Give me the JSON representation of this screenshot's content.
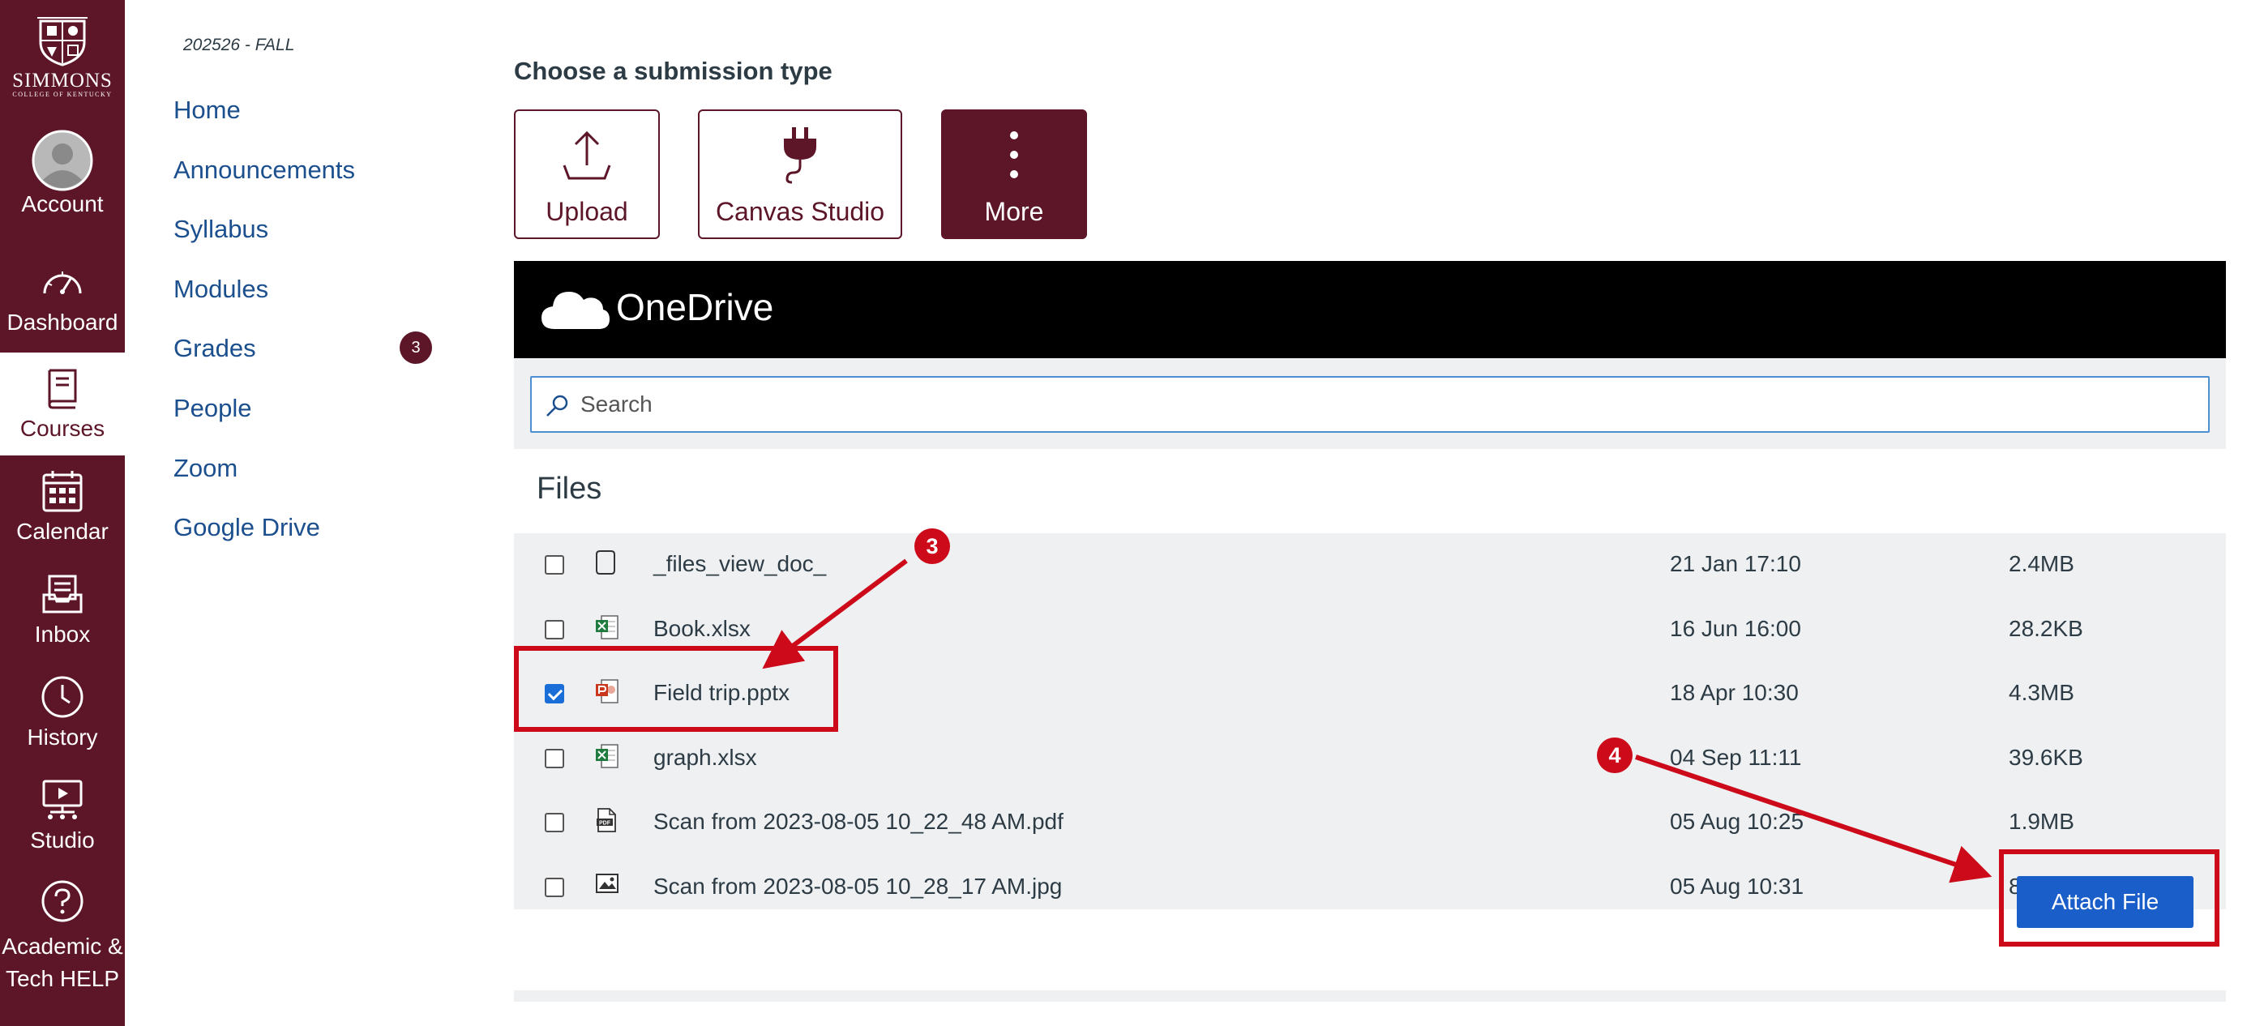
{
  "global_nav": {
    "logo": {
      "name": "SIMMONS",
      "sub": "COLLEGE OF KENTUCKY"
    },
    "items": [
      {
        "label": "Account",
        "icon": "account-avatar-icon"
      },
      {
        "label": "Dashboard",
        "icon": "dashboard-gauge-icon"
      },
      {
        "label": "Courses",
        "icon": "courses-book-icon",
        "active": true
      },
      {
        "label": "Calendar",
        "icon": "calendar-icon"
      },
      {
        "label": "Inbox",
        "icon": "inbox-icon"
      },
      {
        "label": "History",
        "icon": "history-clock-icon"
      },
      {
        "label": "Studio",
        "icon": "studio-icon"
      },
      {
        "label": "Academic & Tech HELP",
        "label_line1": "Academic &",
        "label_line2": "Tech HELP",
        "icon": "help-icon"
      }
    ]
  },
  "course_nav": {
    "term": "202526 - FALL",
    "links": [
      "Home",
      "Announcements",
      "Syllabus",
      "Modules",
      "Grades",
      "People",
      "Zoom",
      "Google Drive"
    ],
    "grades_badge": "3"
  },
  "main": {
    "section_title": "Choose a submission type",
    "submission_types": [
      {
        "label": "Upload",
        "icon": "upload-icon"
      },
      {
        "label": "Canvas Studio",
        "icon": "plug-icon"
      },
      {
        "label": "More",
        "icon": "more-vertical-icon",
        "active": true
      }
    ],
    "onedrive": {
      "title": "OneDrive",
      "search_placeholder": "Search",
      "files_title": "Files",
      "files": [
        {
          "name": "_files_view_doc_",
          "date": "21 Jan 17:10",
          "size": "2.4MB",
          "type": "generic",
          "checked": false
        },
        {
          "name": "Book.xlsx",
          "date": "16 Jun 16:00",
          "size": "28.2KB",
          "type": "excel",
          "checked": false
        },
        {
          "name": "Field trip.pptx",
          "date": "18 Apr 10:30",
          "size": "4.3MB",
          "type": "powerpoint",
          "checked": true
        },
        {
          "name": "graph.xlsx",
          "date": "04 Sep 11:11",
          "size": "39.6KB",
          "type": "excel",
          "checked": false
        },
        {
          "name": "Scan from 2023-08-05 10_22_48 AM.pdf",
          "date": "05 Aug 10:25",
          "size": "1.9MB",
          "type": "pdf",
          "checked": false
        },
        {
          "name": "Scan from 2023-08-05 10_28_17 AM.jpg",
          "date": "05 Aug 10:31",
          "size": "866.9KB",
          "type": "image",
          "checked": false
        }
      ],
      "attach_label": "Attach File"
    }
  },
  "annotations": [
    {
      "number": "3"
    },
    {
      "number": "4"
    }
  ],
  "colors": {
    "brand": "#5c1628",
    "link": "#1c4f8e",
    "annotation": "#cc0a1a",
    "primary_button": "#1a5fc9"
  }
}
